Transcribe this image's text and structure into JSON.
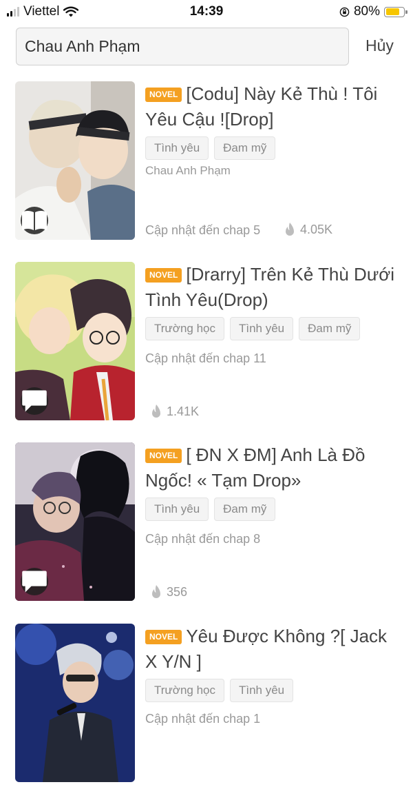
{
  "status_bar": {
    "carrier": "Viettel",
    "time": "14:39",
    "battery_percent": "80%",
    "battery_level": 0.8,
    "signal_bars": 2
  },
  "search": {
    "value": "Chau Anh Phạm",
    "cancel_label": "Hủy"
  },
  "colors": {
    "badge": "#f4a021",
    "battery": "#f7c600"
  },
  "results": [
    {
      "badge": "NOVEL",
      "title": "[Codu] Này Kẻ Thù ! Tôi Yêu Cậu ![Drop]",
      "tags": [
        "Tình yêu",
        "Đam mỹ"
      ],
      "author": "Chau Anh Phạm",
      "update": "Cập nhật đến chap 5",
      "views": "4.05K",
      "cover_icon": "book-icon"
    },
    {
      "badge": "NOVEL",
      "title": "[Drarry] Trên Kẻ Thù Dưới Tình Yêu(Drop)",
      "tags": [
        "Trường học",
        "Tình yêu",
        "Đam mỹ"
      ],
      "update": "Cập nhật đến chap 11",
      "views": "1.41K",
      "cover_icon": "chat-icon"
    },
    {
      "badge": "NOVEL",
      "title": "[ ĐN X ĐM] Anh Là Đồ Ngốc! « Tạm Drop»",
      "tags": [
        "Tình yêu",
        "Đam mỹ"
      ],
      "update": "Cập nhật đến chap 8",
      "views": "356",
      "cover_icon": "chat-icon"
    },
    {
      "badge": "NOVEL",
      "title": "Yêu Được Không ?[ Jack X Y/N ]",
      "tags": [
        "Trường học",
        "Tình yêu"
      ],
      "update": "Cập nhật đến chap 1"
    }
  ]
}
